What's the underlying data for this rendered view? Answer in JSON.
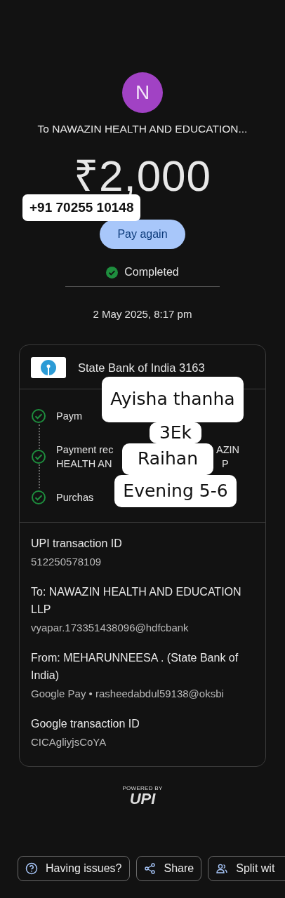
{
  "avatar": {
    "initial": "N"
  },
  "title": "To NAWAZIN HEALTH AND EDUCATION...",
  "amount": "₹2,000",
  "phone_sticker": "+91 70255 10148",
  "pay_again": "Pay again",
  "status": {
    "label": "Completed",
    "completed": true
  },
  "date": "2 May 2025, 8:17 pm",
  "card": {
    "bank": "State Bank of India 3163",
    "steps": [
      {
        "text": "Paym",
        "done": true
      },
      {
        "text": "Payment rec",
        "tail": "AZIN",
        "text2": "HEALTH AN",
        "tail2": "P",
        "done": true
      },
      {
        "text": "Purchas",
        "done": true
      }
    ],
    "details": [
      {
        "label": "UPI transaction ID",
        "value": "512250578109"
      },
      {
        "label": "To: NAWAZIN HEALTH AND EDUCATION LLP",
        "value": "vyapar.173351438096@hdfcbank"
      },
      {
        "label": "From: MEHARUNNEESA  . (State Bank of India)",
        "value": "Google Pay • rasheedabdul59138@oksbi"
      },
      {
        "label": "Google transaction ID",
        "value": "CICAgliyjsCoYA"
      }
    ]
  },
  "note_sticker": [
    "Ayisha thanha",
    "3Ek",
    "Raihan",
    "Evening 5-6"
  ],
  "upi_logo": {
    "top": "POWERED BY",
    "mark": "UPI"
  },
  "actions": [
    {
      "kind": "help",
      "label": "Having issues?"
    },
    {
      "kind": "share",
      "label": "Share"
    },
    {
      "kind": "split",
      "label": "Split wit"
    }
  ]
}
